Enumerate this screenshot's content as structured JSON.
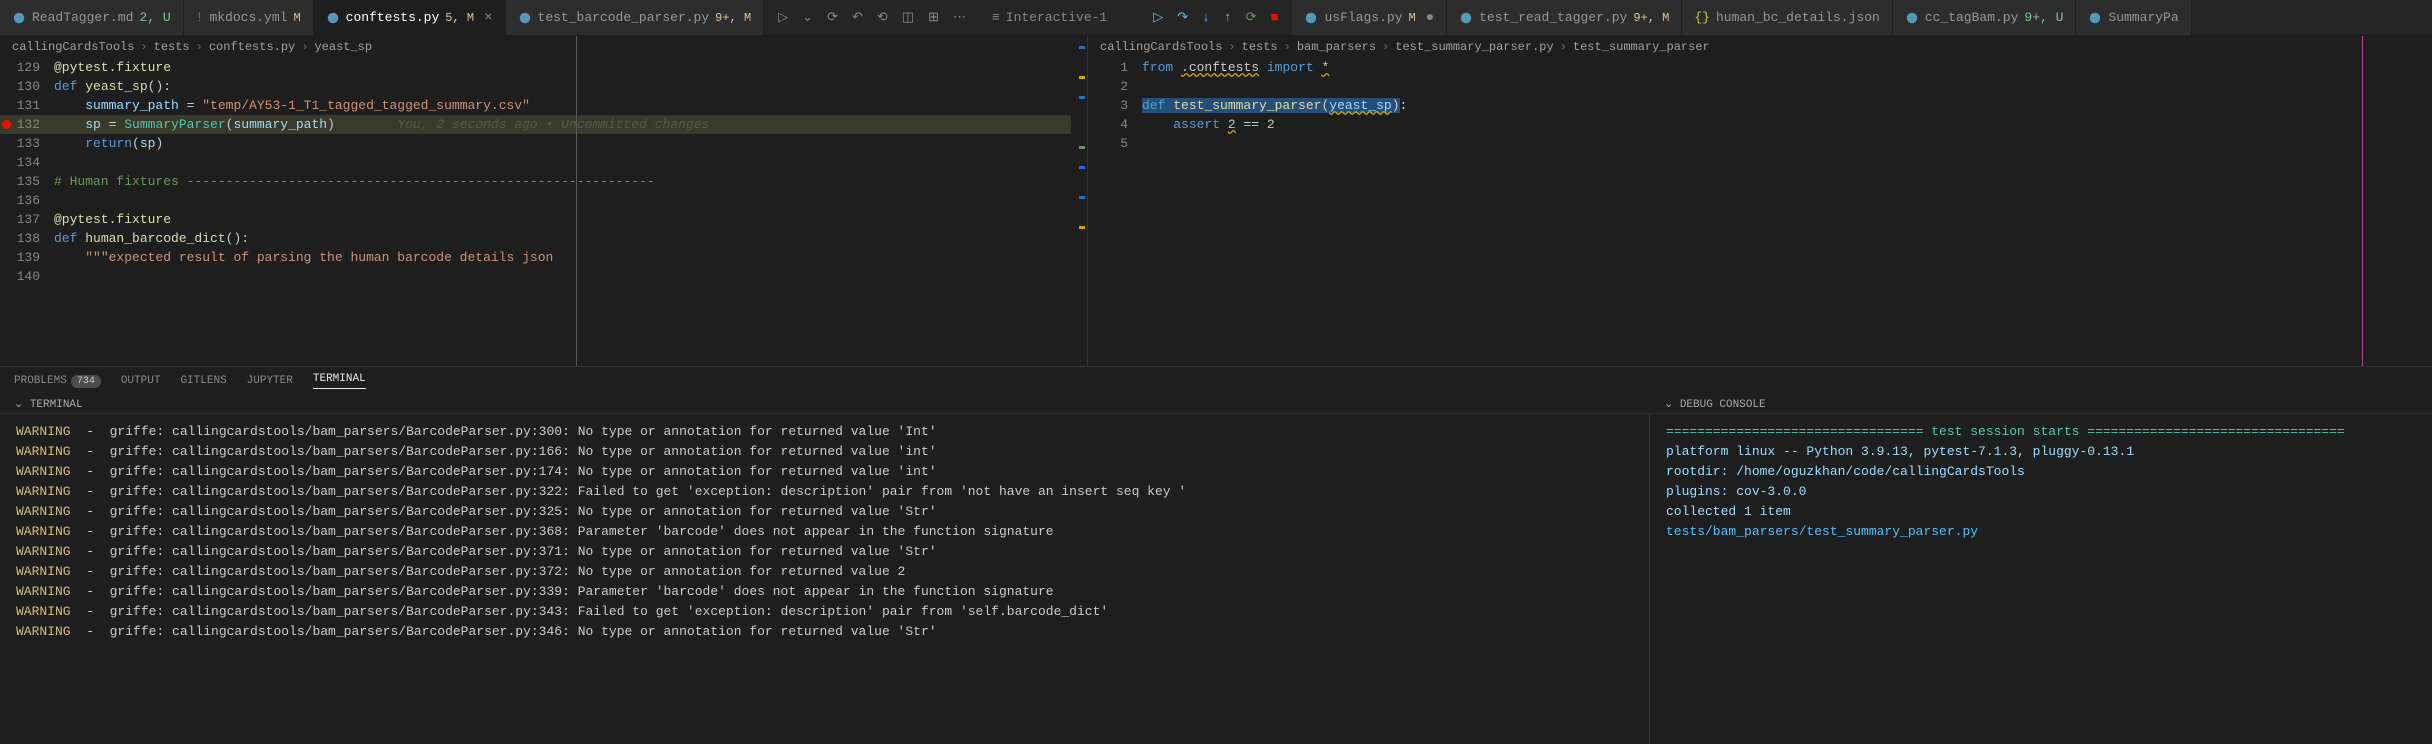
{
  "tabs": {
    "left": [
      {
        "name": "ReadTagger.md",
        "mod": "2, U",
        "modClass": "mod-u",
        "iconColor": "#519aba"
      },
      {
        "name": "mkdocs.yml",
        "mod": "M",
        "modClass": "mod",
        "iconColor": "#cb4b16",
        "prefix": "! "
      },
      {
        "name": "conftests.py",
        "mod": "5, M",
        "modClass": "mod",
        "iconColor": "#519aba",
        "active": true,
        "close": "×"
      },
      {
        "name": "test_barcode_parser.py",
        "mod": "9+, M",
        "modClass": "mod",
        "iconColor": "#519aba"
      }
    ],
    "interactive": "Interactive-1",
    "right": [
      {
        "name": "usFlags.py",
        "mod": "M",
        "modClass": "mod",
        "iconColor": "#519aba",
        "close": "●"
      },
      {
        "name": "test_read_tagger.py",
        "mod": "9+, M",
        "modClass": "mod",
        "iconColor": "#519aba"
      },
      {
        "name": "human_bc_details.json",
        "mod": "",
        "modClass": "",
        "iconColor": "#cbcb41",
        "prefix": "{} "
      },
      {
        "name": "cc_tagBam.py",
        "mod": "9+, U",
        "modClass": "mod-u",
        "iconColor": "#519aba"
      },
      {
        "name": "SummaryPa",
        "mod": "",
        "modClass": "",
        "iconColor": "#519aba"
      }
    ]
  },
  "breadcrumbs": {
    "left": [
      "callingCardsTools",
      "tests",
      "conftests.py",
      "yeast_sp"
    ],
    "right": [
      "callingCardsTools",
      "tests",
      "bam_parsers",
      "test_summary_parser.py",
      "test_summary_parser"
    ]
  },
  "editor": {
    "left": {
      "lines": [
        {
          "n": 129,
          "html": "<span class='k-dec'>@pytest.fixture</span>"
        },
        {
          "n": 130,
          "html": "<span class='k-def'>def</span> <span class='k-fn'>yeast_sp</span>():"
        },
        {
          "n": 131,
          "html": "    <span class='k-var'>summary_path</span> = <span class='k-str'>\"temp/AY53-1_T1_tagged_tagged_summary.csv\"</span>"
        },
        {
          "n": 132,
          "highlight": true,
          "bp": true,
          "html": "    <span class='k-var'>sp</span> = <span class='k-cls'>SummaryParser</span>(<span class='k-var'>summary_path</span>)        <span class='k-annot'>You, 2 seconds ago • Uncommitted changes</span>"
        },
        {
          "n": 133,
          "html": "    <span class='k-def'>return</span>(<span class='k-var'>sp</span>)"
        },
        {
          "n": 134,
          "html": ""
        },
        {
          "n": 135,
          "html": "<span class='k-comment'># Human fixtures ------------------------------------------------------------</span>"
        },
        {
          "n": 136,
          "html": ""
        },
        {
          "n": 137,
          "html": "<span class='k-dec'>@pytest.fixture</span>"
        },
        {
          "n": 138,
          "html": "<span class='k-def'>def</span> <span class='k-fn'>human_barcode_dict</span>():"
        },
        {
          "n": 139,
          "html": "    <span class='k-str'>\"\"\"expected result of parsing the human barcode details json</span>"
        },
        {
          "n": 140,
          "html": ""
        }
      ]
    },
    "right": {
      "lines": [
        {
          "n": 1,
          "html": "<span class='k-def'>from</span> <span class='k-wavy'>.conftests</span> <span class='k-def'>import</span> <span class='k-wavy'>*</span>"
        },
        {
          "n": 2,
          "html": ""
        },
        {
          "n": 3,
          "html": "<span class='k-sel'><span class='k-def'>def</span> <span class='k-fn'>test_summary_parser</span>(<span class='k-wavy k-var'>yeast_sp</span>)</span>:"
        },
        {
          "n": 4,
          "html": "    <span class='k-def'>assert</span> <span class='k-wavy'><span class='k-num'>2</span></span> == <span class='k-num'>2</span>"
        },
        {
          "n": 5,
          "html": ""
        }
      ]
    }
  },
  "panel": {
    "tabs": [
      {
        "label": "PROBLEMS",
        "badge": "734"
      },
      {
        "label": "OUTPUT"
      },
      {
        "label": "GITLENS"
      },
      {
        "label": "JUPYTER"
      },
      {
        "label": "TERMINAL",
        "active": true
      }
    ],
    "left_title": "TERMINAL",
    "right_title": "DEBUG CONSOLE"
  },
  "terminal": [
    "WARNING  -  griffe: callingcardstools/bam_parsers/BarcodeParser.py:300: No type or annotation for returned value 'Int'",
    "WARNING  -  griffe: callingcardstools/bam_parsers/BarcodeParser.py:166: No type or annotation for returned value 'int'",
    "WARNING  -  griffe: callingcardstools/bam_parsers/BarcodeParser.py:174: No type or annotation for returned value 'int'",
    "WARNING  -  griffe: callingcardstools/bam_parsers/BarcodeParser.py:322: Failed to get 'exception: description' pair from 'not have an insert seq key '",
    "WARNING  -  griffe: callingcardstools/bam_parsers/BarcodeParser.py:325: No type or annotation for returned value 'Str'",
    "WARNING  -  griffe: callingcardstools/bam_parsers/BarcodeParser.py:368: Parameter 'barcode' does not appear in the function signature",
    "WARNING  -  griffe: callingcardstools/bam_parsers/BarcodeParser.py:371: No type or annotation for returned value 'Str'",
    "WARNING  -  griffe: callingcardstools/bam_parsers/BarcodeParser.py:372: No type or annotation for returned value 2",
    "WARNING  -  griffe: callingcardstools/bam_parsers/BarcodeParser.py:339: Parameter 'barcode' does not appear in the function signature",
    "WARNING  -  griffe: callingcardstools/bam_parsers/BarcodeParser.py:343: Failed to get 'exception: description' pair from 'self.barcode_dict'",
    "WARNING  -  griffe: callingcardstools/bam_parsers/BarcodeParser.py:346: No type or annotation for returned value 'Str'"
  ],
  "debug_console": [
    {
      "cls": "dc-sep",
      "text": "================================= test session starts ================================="
    },
    {
      "cls": "dc-text",
      "text": "platform linux -- Python 3.9.13, pytest-7.1.3, pluggy-0.13.1"
    },
    {
      "cls": "dc-text",
      "text": "rootdir: /home/oguzkhan/code/callingCardsTools"
    },
    {
      "cls": "dc-text",
      "text": "plugins: cov-3.0.0"
    },
    {
      "cls": "dc-text",
      "text": "collected 1 item"
    },
    {
      "cls": "",
      "text": ""
    },
    {
      "cls": "dc-link",
      "text": "tests/bam_parsers/test_summary_parser.py"
    }
  ]
}
